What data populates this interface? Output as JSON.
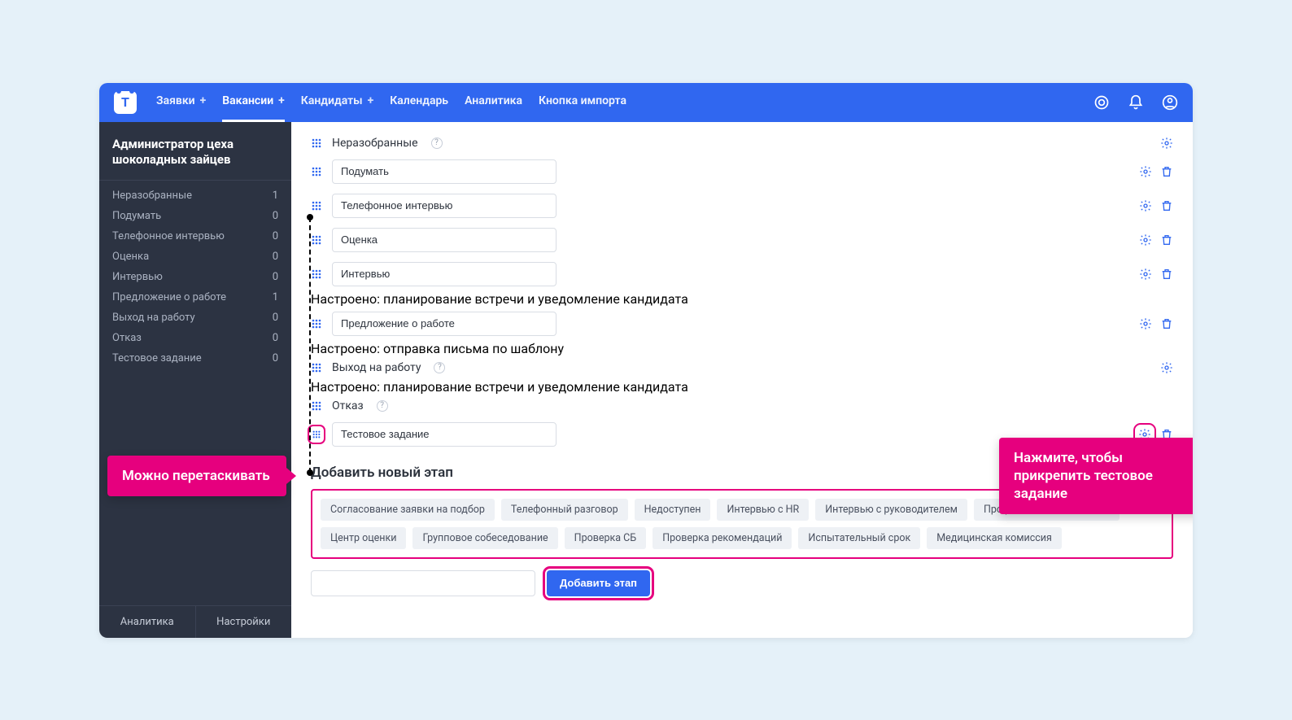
{
  "topbar": {
    "logo_letter": "T",
    "nav": [
      {
        "label": "Заявки",
        "has_plus": true,
        "active": false
      },
      {
        "label": "Вакансии",
        "has_plus": true,
        "active": true
      },
      {
        "label": "Кандидаты",
        "has_plus": true,
        "active": false
      },
      {
        "label": "Календарь",
        "has_plus": false,
        "active": false
      },
      {
        "label": "Аналитика",
        "has_plus": false,
        "active": false
      },
      {
        "label": "Кнопка импорта",
        "has_plus": false,
        "active": false
      }
    ]
  },
  "sidebar": {
    "title": "Администратор цеха шоколадных зайцев",
    "items": [
      {
        "label": "Неразобранные",
        "count": "1"
      },
      {
        "label": "Подумать",
        "count": "0"
      },
      {
        "label": "Телефонное интервью",
        "count": "0"
      },
      {
        "label": "Оценка",
        "count": "0"
      },
      {
        "label": "Интервью",
        "count": "0"
      },
      {
        "label": "Предложение о работе",
        "count": "1"
      },
      {
        "label": "Выход на работу",
        "count": "0"
      },
      {
        "label": "Отказ",
        "count": "0"
      },
      {
        "label": "Тестовое задание",
        "count": "0"
      }
    ],
    "footer": {
      "analytics": "Аналитика",
      "settings": "Настройки"
    }
  },
  "stages": [
    {
      "type": "static",
      "label": "Неразобранные",
      "qmark": true,
      "gear": true,
      "trash": false
    },
    {
      "type": "input",
      "value": "Подумать",
      "gear": true,
      "trash": true
    },
    {
      "type": "input",
      "value": "Телефонное интервью",
      "gear": true,
      "trash": true
    },
    {
      "type": "input",
      "value": "Оценка",
      "gear": true,
      "trash": true
    },
    {
      "type": "input",
      "value": "Интервью",
      "gear": true,
      "trash": true,
      "note": "Настроено: планирование встречи и уведомление кандидата"
    },
    {
      "type": "input",
      "value": "Предложение о работе",
      "gear": true,
      "trash": true,
      "note": "Настроено: отправка письма по шаблону"
    },
    {
      "type": "static",
      "label": "Выход на работу",
      "qmark": true,
      "gear": true,
      "trash": false,
      "note": "Настроено: планирование встречи и уведомление кандидата"
    },
    {
      "type": "static",
      "label": "Отказ",
      "qmark": true,
      "gear": false,
      "trash": false
    },
    {
      "type": "input",
      "value": "Тестовое задание",
      "gear": true,
      "trash": true,
      "drag_highlight": true,
      "gear_highlight": true
    }
  ],
  "add_section": {
    "title": "Добавить новый этап",
    "chips": [
      "Согласование заявки на подбор",
      "Телефонный разговор",
      "Недоступен",
      "Интервью с HR",
      "Интервью с руководителем",
      "Профессиональные тесты",
      "Центр оценки",
      "Групповое собеседование",
      "Проверка СБ",
      "Проверка рекомендаций",
      "Испытательный срок",
      "Медицинская комиссия"
    ],
    "new_stage_value": "",
    "button": "Добавить этап"
  },
  "callouts": {
    "left": "Можно перетаскивать",
    "right": "Нажмите, чтобы прикрепить тестовое задание"
  }
}
